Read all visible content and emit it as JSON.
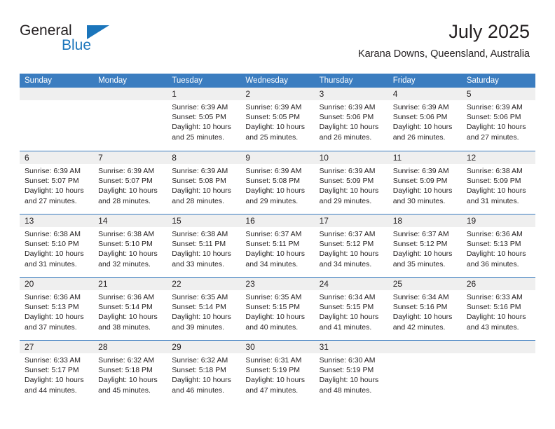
{
  "brand": {
    "name_part1": "General",
    "name_part2": "Blue",
    "flag_icon": "triangle-flag-icon",
    "accent_color": "#1b75bb"
  },
  "header": {
    "title": "July 2025",
    "location": "Karana Downs, Queensland, Australia"
  },
  "theme": {
    "header_blue": "#3b7dc0",
    "day_band_gray": "#efefef",
    "text_color": "#231f20"
  },
  "weekdays": [
    "Sunday",
    "Monday",
    "Tuesday",
    "Wednesday",
    "Thursday",
    "Friday",
    "Saturday"
  ],
  "weeks": [
    [
      {
        "day": "",
        "lines": []
      },
      {
        "day": "",
        "lines": []
      },
      {
        "day": "1",
        "lines": [
          "Sunrise: 6:39 AM",
          "Sunset: 5:05 PM",
          "Daylight: 10 hours",
          "and 25 minutes."
        ]
      },
      {
        "day": "2",
        "lines": [
          "Sunrise: 6:39 AM",
          "Sunset: 5:05 PM",
          "Daylight: 10 hours",
          "and 25 minutes."
        ]
      },
      {
        "day": "3",
        "lines": [
          "Sunrise: 6:39 AM",
          "Sunset: 5:06 PM",
          "Daylight: 10 hours",
          "and 26 minutes."
        ]
      },
      {
        "day": "4",
        "lines": [
          "Sunrise: 6:39 AM",
          "Sunset: 5:06 PM",
          "Daylight: 10 hours",
          "and 26 minutes."
        ]
      },
      {
        "day": "5",
        "lines": [
          "Sunrise: 6:39 AM",
          "Sunset: 5:06 PM",
          "Daylight: 10 hours",
          "and 27 minutes."
        ]
      }
    ],
    [
      {
        "day": "6",
        "lines": [
          "Sunrise: 6:39 AM",
          "Sunset: 5:07 PM",
          "Daylight: 10 hours",
          "and 27 minutes."
        ]
      },
      {
        "day": "7",
        "lines": [
          "Sunrise: 6:39 AM",
          "Sunset: 5:07 PM",
          "Daylight: 10 hours",
          "and 28 minutes."
        ]
      },
      {
        "day": "8",
        "lines": [
          "Sunrise: 6:39 AM",
          "Sunset: 5:08 PM",
          "Daylight: 10 hours",
          "and 28 minutes."
        ]
      },
      {
        "day": "9",
        "lines": [
          "Sunrise: 6:39 AM",
          "Sunset: 5:08 PM",
          "Daylight: 10 hours",
          "and 29 minutes."
        ]
      },
      {
        "day": "10",
        "lines": [
          "Sunrise: 6:39 AM",
          "Sunset: 5:09 PM",
          "Daylight: 10 hours",
          "and 29 minutes."
        ]
      },
      {
        "day": "11",
        "lines": [
          "Sunrise: 6:39 AM",
          "Sunset: 5:09 PM",
          "Daylight: 10 hours",
          "and 30 minutes."
        ]
      },
      {
        "day": "12",
        "lines": [
          "Sunrise: 6:38 AM",
          "Sunset: 5:09 PM",
          "Daylight: 10 hours",
          "and 31 minutes."
        ]
      }
    ],
    [
      {
        "day": "13",
        "lines": [
          "Sunrise: 6:38 AM",
          "Sunset: 5:10 PM",
          "Daylight: 10 hours",
          "and 31 minutes."
        ]
      },
      {
        "day": "14",
        "lines": [
          "Sunrise: 6:38 AM",
          "Sunset: 5:10 PM",
          "Daylight: 10 hours",
          "and 32 minutes."
        ]
      },
      {
        "day": "15",
        "lines": [
          "Sunrise: 6:38 AM",
          "Sunset: 5:11 PM",
          "Daylight: 10 hours",
          "and 33 minutes."
        ]
      },
      {
        "day": "16",
        "lines": [
          "Sunrise: 6:37 AM",
          "Sunset: 5:11 PM",
          "Daylight: 10 hours",
          "and 34 minutes."
        ]
      },
      {
        "day": "17",
        "lines": [
          "Sunrise: 6:37 AM",
          "Sunset: 5:12 PM",
          "Daylight: 10 hours",
          "and 34 minutes."
        ]
      },
      {
        "day": "18",
        "lines": [
          "Sunrise: 6:37 AM",
          "Sunset: 5:12 PM",
          "Daylight: 10 hours",
          "and 35 minutes."
        ]
      },
      {
        "day": "19",
        "lines": [
          "Sunrise: 6:36 AM",
          "Sunset: 5:13 PM",
          "Daylight: 10 hours",
          "and 36 minutes."
        ]
      }
    ],
    [
      {
        "day": "20",
        "lines": [
          "Sunrise: 6:36 AM",
          "Sunset: 5:13 PM",
          "Daylight: 10 hours",
          "and 37 minutes."
        ]
      },
      {
        "day": "21",
        "lines": [
          "Sunrise: 6:36 AM",
          "Sunset: 5:14 PM",
          "Daylight: 10 hours",
          "and 38 minutes."
        ]
      },
      {
        "day": "22",
        "lines": [
          "Sunrise: 6:35 AM",
          "Sunset: 5:14 PM",
          "Daylight: 10 hours",
          "and 39 minutes."
        ]
      },
      {
        "day": "23",
        "lines": [
          "Sunrise: 6:35 AM",
          "Sunset: 5:15 PM",
          "Daylight: 10 hours",
          "and 40 minutes."
        ]
      },
      {
        "day": "24",
        "lines": [
          "Sunrise: 6:34 AM",
          "Sunset: 5:15 PM",
          "Daylight: 10 hours",
          "and 41 minutes."
        ]
      },
      {
        "day": "25",
        "lines": [
          "Sunrise: 6:34 AM",
          "Sunset: 5:16 PM",
          "Daylight: 10 hours",
          "and 42 minutes."
        ]
      },
      {
        "day": "26",
        "lines": [
          "Sunrise: 6:33 AM",
          "Sunset: 5:16 PM",
          "Daylight: 10 hours",
          "and 43 minutes."
        ]
      }
    ],
    [
      {
        "day": "27",
        "lines": [
          "Sunrise: 6:33 AM",
          "Sunset: 5:17 PM",
          "Daylight: 10 hours",
          "and 44 minutes."
        ]
      },
      {
        "day": "28",
        "lines": [
          "Sunrise: 6:32 AM",
          "Sunset: 5:18 PM",
          "Daylight: 10 hours",
          "and 45 minutes."
        ]
      },
      {
        "day": "29",
        "lines": [
          "Sunrise: 6:32 AM",
          "Sunset: 5:18 PM",
          "Daylight: 10 hours",
          "and 46 minutes."
        ]
      },
      {
        "day": "30",
        "lines": [
          "Sunrise: 6:31 AM",
          "Sunset: 5:19 PM",
          "Daylight: 10 hours",
          "and 47 minutes."
        ]
      },
      {
        "day": "31",
        "lines": [
          "Sunrise: 6:30 AM",
          "Sunset: 5:19 PM",
          "Daylight: 10 hours",
          "and 48 minutes."
        ]
      },
      {
        "day": "",
        "lines": []
      },
      {
        "day": "",
        "lines": []
      }
    ]
  ]
}
